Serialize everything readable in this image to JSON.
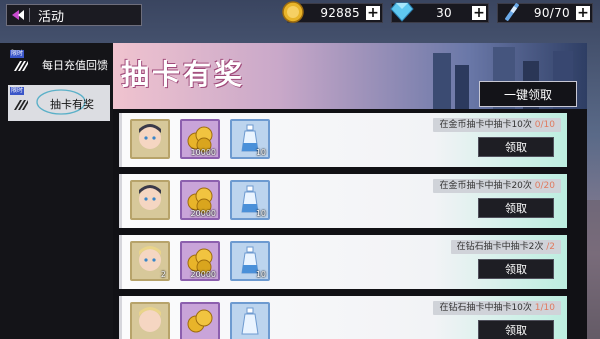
{
  "topbar": {
    "back_title": "活动",
    "resources": [
      {
        "name": "gold-coin",
        "value": "92885"
      },
      {
        "name": "diamond",
        "value": "30"
      },
      {
        "name": "stamina",
        "value": "90/70"
      }
    ]
  },
  "sidebar": {
    "items": [
      {
        "badge": "限时",
        "label": "每日充值回馈",
        "selected": false
      },
      {
        "badge": "限时",
        "label": "抽卡有奖",
        "selected": true
      }
    ]
  },
  "main": {
    "title": "抽卡有奖",
    "claim_all_label": "一键领取",
    "rows": [
      {
        "task": "在金币抽卡中抽卡10次",
        "progress": "0/10",
        "claim_label": "领取",
        "rewards": [
          {
            "type": "character-card",
            "count": ""
          },
          {
            "type": "gold-coins",
            "count": "10000"
          },
          {
            "type": "potion-bottle",
            "count": "10"
          }
        ]
      },
      {
        "task": "在金币抽卡中抽卡20次",
        "progress": "0/20",
        "claim_label": "领取",
        "rewards": [
          {
            "type": "character-card",
            "count": ""
          },
          {
            "type": "gold-coins",
            "count": "20000"
          },
          {
            "type": "potion-bottle",
            "count": "10"
          }
        ]
      },
      {
        "task": "在钻石抽卡中抽卡2次",
        "progress": "/2",
        "claim_label": "领取",
        "rewards": [
          {
            "type": "character-card",
            "count": "2"
          },
          {
            "type": "gold-coins",
            "count": "20000"
          },
          {
            "type": "potion-bottle",
            "count": "10"
          }
        ]
      },
      {
        "task": "在钻石抽卡中抽卡10次",
        "progress": "1/10",
        "claim_label": "领取",
        "rewards": [
          {
            "type": "character-card",
            "count": ""
          },
          {
            "type": "gold-coins",
            "count": ""
          },
          {
            "type": "potion-bottle",
            "count": ""
          }
        ]
      }
    ]
  }
}
